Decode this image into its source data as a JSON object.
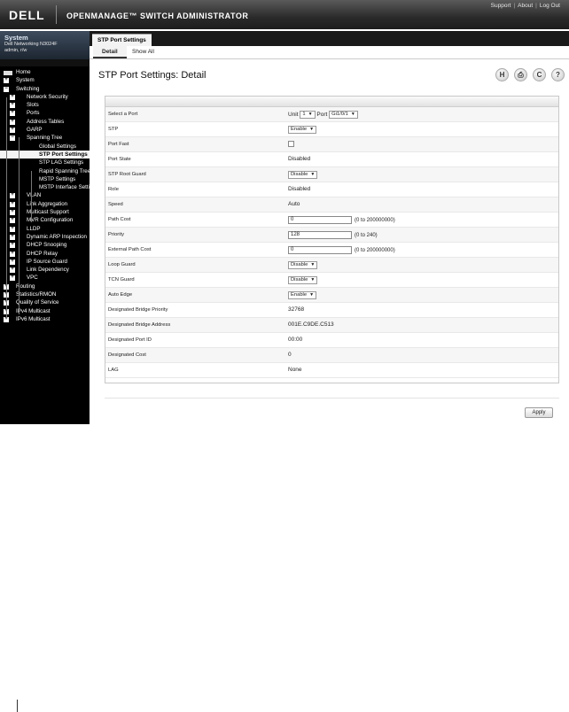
{
  "header": {
    "logo": "DELL",
    "product": "OPENMANAGE™ SWITCH ADMINISTRATOR",
    "links": [
      "Support",
      "About",
      "Log Out"
    ]
  },
  "sidebar": {
    "system_title": "System",
    "model": "Dell Networking N3024F",
    "user": "admin, r/w",
    "tree": [
      {
        "label": "Home",
        "level": 0,
        "box": "icon",
        "selected": false
      },
      {
        "label": "System",
        "level": 0,
        "box": "+",
        "selected": false
      },
      {
        "label": "Switching",
        "level": 0,
        "box": "-",
        "selected": false
      },
      {
        "label": "Network Security",
        "level": 1,
        "box": "+",
        "selected": false
      },
      {
        "label": "Slots",
        "level": 1,
        "box": "+",
        "selected": false
      },
      {
        "label": "Ports",
        "level": 1,
        "box": "+",
        "selected": false
      },
      {
        "label": "Address Tables",
        "level": 1,
        "box": "+",
        "selected": false
      },
      {
        "label": "GARP",
        "level": 1,
        "box": "+",
        "selected": false
      },
      {
        "label": "Spanning Tree",
        "level": 1,
        "box": "-",
        "selected": false
      },
      {
        "label": "Global Settings",
        "level": 2,
        "box": "",
        "selected": false
      },
      {
        "label": "STP Port Settings",
        "level": 2,
        "box": "",
        "selected": true
      },
      {
        "label": "STP LAG Settings",
        "level": 2,
        "box": "",
        "selected": false
      },
      {
        "label": "Rapid Spanning Tree",
        "level": 2,
        "box": "",
        "selected": false
      },
      {
        "label": "MSTP Settings",
        "level": 2,
        "box": "",
        "selected": false
      },
      {
        "label": "MSTP Interface Settings",
        "level": 2,
        "box": "",
        "selected": false
      },
      {
        "label": "VLAN",
        "level": 1,
        "box": "+",
        "selected": false
      },
      {
        "label": "Link Aggregation",
        "level": 1,
        "box": "+",
        "selected": false
      },
      {
        "label": "Multicast Support",
        "level": 1,
        "box": "+",
        "selected": false
      },
      {
        "label": "MVR Configuration",
        "level": 1,
        "box": "+",
        "selected": false
      },
      {
        "label": "LLDP",
        "level": 1,
        "box": "+",
        "selected": false
      },
      {
        "label": "Dynamic ARP Inspection",
        "level": 1,
        "box": "+",
        "selected": false
      },
      {
        "label": "DHCP Snooping",
        "level": 1,
        "box": "+",
        "selected": false
      },
      {
        "label": "DHCP Relay",
        "level": 1,
        "box": "+",
        "selected": false
      },
      {
        "label": "IP Source Guard",
        "level": 1,
        "box": "+",
        "selected": false
      },
      {
        "label": "Link Dependency",
        "level": 1,
        "box": "+",
        "selected": false
      },
      {
        "label": "VPC",
        "level": 1,
        "box": "+",
        "selected": false
      },
      {
        "label": "Routing",
        "level": 0,
        "box": "+",
        "selected": false
      },
      {
        "label": "Statistics/RMON",
        "level": 0,
        "box": "+",
        "selected": false
      },
      {
        "label": "Quality of Service",
        "level": 0,
        "box": "+",
        "selected": false
      },
      {
        "label": "IPv4 Multicast",
        "level": 0,
        "box": "+",
        "selected": false
      },
      {
        "label": "IPv6 Multicast",
        "level": 0,
        "box": "+",
        "selected": false
      }
    ]
  },
  "main": {
    "tab": "STP Port Settings",
    "subtabs": [
      "Detail",
      "Show All"
    ],
    "title": "STP Port Settings: Detail",
    "toolbar_icons": [
      {
        "name": "save-icon",
        "glyph": "H"
      },
      {
        "name": "print-icon",
        "glyph": "⎙"
      },
      {
        "name": "refresh-icon",
        "glyph": "C"
      },
      {
        "name": "help-icon",
        "glyph": "?"
      }
    ],
    "rows": [
      {
        "label": "Select a Port",
        "kind": "port",
        "unit_label": "Unit",
        "unit": "1",
        "port_label": "Port",
        "port": "Gi1/0/1"
      },
      {
        "label": "STP",
        "kind": "select",
        "value": "Enable"
      },
      {
        "label": "Port Fast",
        "kind": "checkbox"
      },
      {
        "label": "Port State",
        "kind": "text",
        "value": "Disabled"
      },
      {
        "label": "STP Root Guard",
        "kind": "select",
        "value": "Disable"
      },
      {
        "label": "Role",
        "kind": "text",
        "value": "Disabled"
      },
      {
        "label": "Speed",
        "kind": "text",
        "value": "Auto"
      },
      {
        "label": "Path Cost",
        "kind": "input",
        "value": "0",
        "hint": "(0 to 200000000)"
      },
      {
        "label": "Priority",
        "kind": "input",
        "value": "128",
        "hint": "(0 to 240)"
      },
      {
        "label": "External Path Cost",
        "kind": "input",
        "value": "0",
        "hint": "(0 to 200000000)"
      },
      {
        "label": "Loop Guard",
        "kind": "select",
        "value": "Disable"
      },
      {
        "label": "TCN Guard",
        "kind": "select",
        "value": "Disable"
      },
      {
        "label": "Auto Edge",
        "kind": "select",
        "value": "Enable"
      },
      {
        "label": "Designated Bridge Priority",
        "kind": "text",
        "value": "32768"
      },
      {
        "label": "Designated Bridge Address",
        "kind": "text",
        "value": "001E.C9DE.C513"
      },
      {
        "label": "Designated Port ID",
        "kind": "text",
        "value": "00:00"
      },
      {
        "label": "Designated Cost",
        "kind": "text",
        "value": "0"
      },
      {
        "label": "LAG",
        "kind": "text",
        "value": "None"
      }
    ],
    "apply_label": "Apply"
  }
}
